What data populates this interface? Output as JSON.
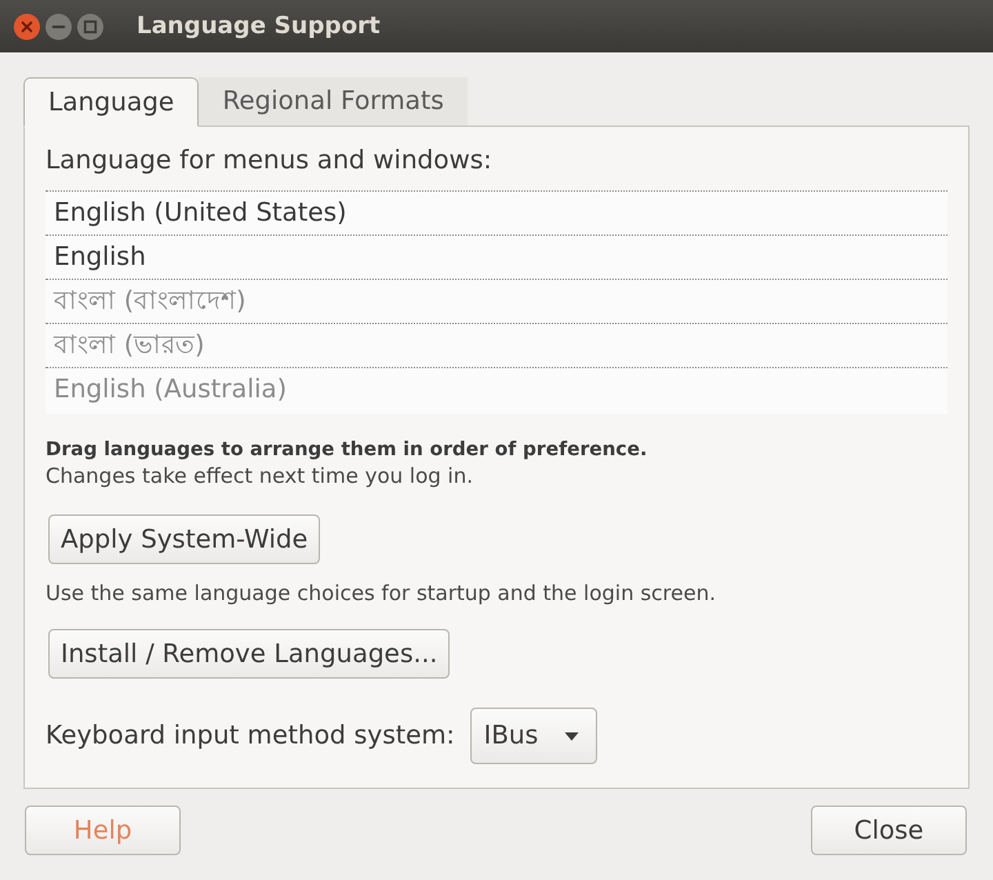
{
  "window": {
    "title": "Language Support"
  },
  "tabs": [
    {
      "label": "Language",
      "selected": true
    },
    {
      "label": "Regional Formats",
      "selected": false
    }
  ],
  "language_list": {
    "label": "Language for menus and windows:",
    "items": [
      {
        "name": "English (United States)",
        "dimmed": false
      },
      {
        "name": "English",
        "dimmed": false
      },
      {
        "name": "বাংলা (বাংলাদেশ)",
        "dimmed": true
      },
      {
        "name": "বাংলা (ভারত)",
        "dimmed": true
      },
      {
        "name": "English (Australia)",
        "dimmed": true
      }
    ]
  },
  "hint": {
    "title": "Drag languages to arrange them in order of preference.",
    "text": "Changes take effect next time you log in."
  },
  "apply_button": "Apply System-Wide",
  "apply_note": "Use the same language choices for startup and the login screen.",
  "install_button": "Install / Remove Languages...",
  "input_method": {
    "label": "Keyboard input method system:",
    "value": "IBus"
  },
  "buttons": [
    {
      "label": "Help",
      "kind": "help"
    },
    {
      "label": "Close",
      "kind": "normal"
    }
  ]
}
